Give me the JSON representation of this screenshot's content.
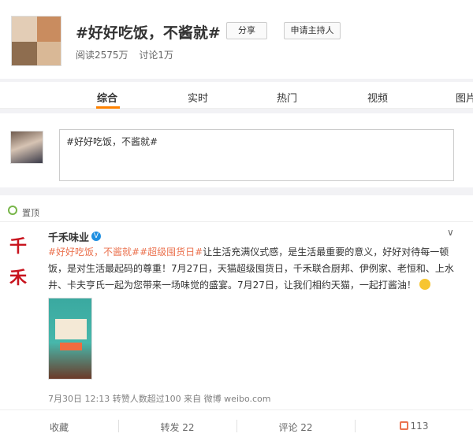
{
  "topic": {
    "title": "#好好吃饭，不酱就#",
    "share_label": "分享",
    "apply_host_label": "申请主持人",
    "reads": "阅读2575万",
    "discussions": "讨论1万"
  },
  "tabs": [
    {
      "label": "综合"
    },
    {
      "label": "实时"
    },
    {
      "label": "热门"
    },
    {
      "label": "视频"
    },
    {
      "label": "图片"
    }
  ],
  "composer": {
    "text": "#好好吃饭，不酱就#"
  },
  "feed": {
    "pinned_label": "置顶",
    "post": {
      "author": "千禾味业",
      "logo_text": "千禾",
      "tag1": "#好好吃饭，不酱就#",
      "tag2": "#超级囤货日#",
      "body": "让生活充满仪式感，是生活最重要的意义，好好对待每一顿饭，是对生活最起码的尊重！7月27日，天猫超级囤货日，千禾联合厨邦、伊例家、老恒和、上水井、卡夫亨氏一起为您带来一场味觉的盛宴。7月27日，让我们相约天猫，一起打酱油！",
      "meta": "7月30日 12:13 转赞人数超过100 来自 微博 weibo.com"
    },
    "actions": {
      "favorite": "收藏",
      "repost": "转发 22",
      "comment": "评论 22",
      "like": "113"
    }
  },
  "colors": {
    "accent": "#ff8200",
    "tag": "#eb7350",
    "verified": "#1e8fe1"
  }
}
